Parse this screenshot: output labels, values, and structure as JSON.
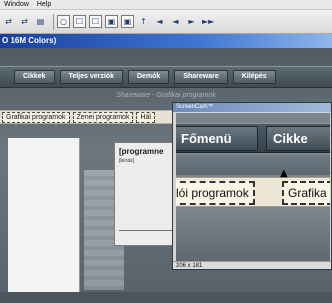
{
  "menubar": {
    "items": [
      "Window",
      "Help"
    ]
  },
  "toolbar": {
    "buttons": [
      "⇄",
      "⇄",
      "▤",
      "○",
      "☐",
      "☐",
      "▣",
      "▣",
      "↑",
      "◄",
      "◄",
      "►",
      "►►"
    ]
  },
  "window": {
    "title": "O 16M Colors)"
  },
  "nav": {
    "items": [
      "Cikkek",
      "Teljes verziók",
      "Demók",
      "Shareware",
      "Kilépés"
    ]
  },
  "subheader": "Shareware - Grafikai programok",
  "tabs": {
    "items": [
      "Grafikai programok",
      "Zenei programok",
      "Hál"
    ]
  },
  "dialog": {
    "title": "[programne",
    "subtitle": "[leírás]"
  },
  "magnifier": {
    "window_title": "ScreenCam™",
    "nav_items": [
      "Főmenü",
      "Cikke"
    ],
    "tab_items": [
      "lói programok",
      "Grafika"
    ],
    "status": "206 x 181"
  },
  "colors": {
    "titlebar": "#1a3f9c",
    "nav_bg": "#3f4a52",
    "tab_bg": "#ece6d4"
  }
}
